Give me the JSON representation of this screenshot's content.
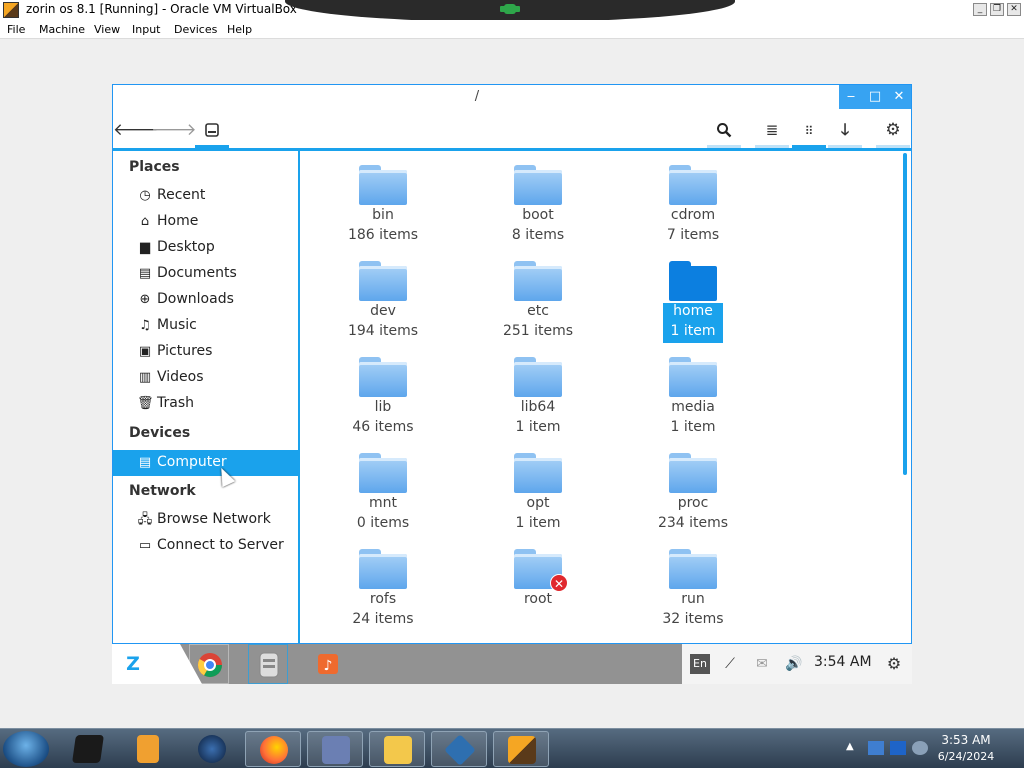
{
  "host_window": {
    "title": "zorin os 8.1 [Running] - Oracle VM VirtualBox",
    "controls": {
      "minimize": "_",
      "restore": "❐",
      "close": "✕"
    }
  },
  "host_menu": [
    "File",
    "Machine",
    "View",
    "Input",
    "Devices",
    "Help"
  ],
  "file_manager": {
    "title": "/",
    "window_controls": {
      "minimize": "‒",
      "maximize": "□",
      "close": "✕"
    },
    "toolbar": {
      "back_icon": "arrow-left-icon",
      "forward_icon": "arrow-right-icon",
      "location_icon": "drive-icon",
      "search_icon": "search-icon",
      "list_view_icon": "list-view-icon",
      "grid_view_icon": "grid-view-icon",
      "download_icon": "download-icon",
      "settings_icon": "gear-icon"
    },
    "sidebar": {
      "places_header": "Places",
      "places": [
        {
          "label": "Recent",
          "icon": "clock-icon"
        },
        {
          "label": "Home",
          "icon": "home-icon"
        },
        {
          "label": "Desktop",
          "icon": "folder-icon"
        },
        {
          "label": "Documents",
          "icon": "document-icon"
        },
        {
          "label": "Downloads",
          "icon": "download-icon"
        },
        {
          "label": "Music",
          "icon": "music-icon"
        },
        {
          "label": "Pictures",
          "icon": "picture-icon"
        },
        {
          "label": "Videos",
          "icon": "film-icon"
        },
        {
          "label": "Trash",
          "icon": "trash-icon"
        }
      ],
      "devices_header": "Devices",
      "devices": [
        {
          "label": "Computer",
          "icon": "drive-icon",
          "selected": true
        }
      ],
      "network_header": "Network",
      "network": [
        {
          "label": "Browse Network",
          "icon": "network-icon"
        },
        {
          "label": "Connect to Server",
          "icon": "server-icon"
        }
      ]
    },
    "items": [
      {
        "name": "bin",
        "count": "186 items"
      },
      {
        "name": "boot",
        "count": "8 items"
      },
      {
        "name": "cdrom",
        "count": "7 items"
      },
      {
        "name": "dev",
        "count": "194 items"
      },
      {
        "name": "etc",
        "count": "251 items"
      },
      {
        "name": "home",
        "count": "1 item",
        "selected": true
      },
      {
        "name": "lib",
        "count": "46 items"
      },
      {
        "name": "lib64",
        "count": "1 item"
      },
      {
        "name": "media",
        "count": "1 item"
      },
      {
        "name": "mnt",
        "count": "0 items"
      },
      {
        "name": "opt",
        "count": "1 item"
      },
      {
        "name": "proc",
        "count": "234 items"
      },
      {
        "name": "rofs",
        "count": "24 items"
      },
      {
        "name": "root",
        "count": "",
        "badge": "✕"
      },
      {
        "name": "run",
        "count": "32 items"
      }
    ]
  },
  "guest_panel": {
    "logo": "Z",
    "apps": [
      "chrome-icon",
      "file-manager-icon",
      "music-player-icon"
    ],
    "tray": {
      "keyboard_layout": "En",
      "network_icon": "network-icon",
      "mail_icon": "mail-icon",
      "volume_icon": "volume-icon",
      "clock": "3:54 AM",
      "settings_icon": "gear-icon"
    }
  },
  "win_taskbar": {
    "start_icon": "windows-start-icon",
    "pins": [
      "terminal-icon",
      "media-player-icon",
      "globe-icon",
      "firefox-icon",
      "checklist-icon",
      "file-explorer-icon",
      "virtualbox-icon",
      "virtualbox-64-icon"
    ],
    "clock_time": "3:53 AM",
    "clock_date": "6/24/2024"
  },
  "colors": {
    "accent": "#1aa2ec",
    "folder": "#5ea6ec",
    "selected_folder": "#0c7fe0",
    "error_badge": "#e0282e"
  }
}
